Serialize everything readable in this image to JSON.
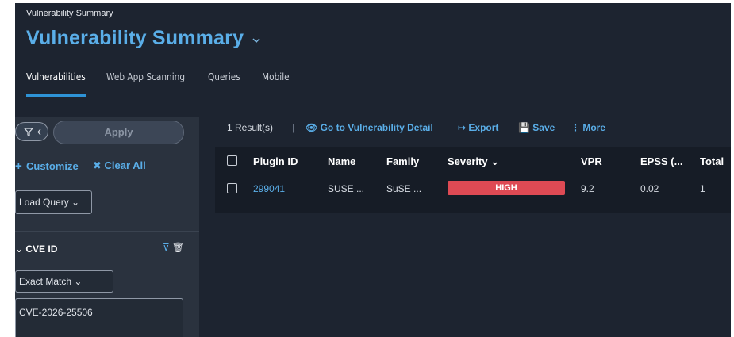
{
  "header": {
    "breadcrumb": "Vulnerability Summary",
    "title": "Vulnerability Summary",
    "title_chevron_icon": "chevron-down-icon"
  },
  "tabs": [
    {
      "label": "Vulnerabilities",
      "active": true
    },
    {
      "label": "Web App Scanning",
      "active": false
    },
    {
      "label": "Queries",
      "active": false
    },
    {
      "label": "Mobile",
      "active": false
    }
  ],
  "sidebar": {
    "filter_button": "⊽‹",
    "apply_label": "Apply",
    "customize_label": "Customize",
    "clear_all_label": "✖ Clear All",
    "load_query_label": "Load Query ⌄",
    "section": {
      "title": "⌄ CVE ID",
      "filter_icon": "⊽",
      "trash_icon": "🗑",
      "match_label": "Exact Match ⌄",
      "value": "CVE-2026-25506"
    }
  },
  "toolbar": {
    "result_count": "1 Result(s)",
    "separator": "|",
    "goto_detail": "👁 Go to Vulnerability Detail",
    "export": "↦ Export",
    "save": "💾 Save",
    "more": "⋮ More"
  },
  "table": {
    "headers": [
      "Plugin ID",
      "Name",
      "Family",
      "Severity ⌄",
      "VPR",
      "EPSS (...",
      "Total"
    ],
    "rows": [
      {
        "plugin_id": "299041",
        "name": "SUSE ...",
        "family": "SuSE ...",
        "severity": "HIGH",
        "vpr": "9.2",
        "epss": "0.02",
        "total": "1"
      }
    ]
  },
  "colors": {
    "accent": "#5aaee8",
    "severity_high": "#de4a54",
    "background": "#1d2430",
    "sidebar": "#2a323e"
  }
}
